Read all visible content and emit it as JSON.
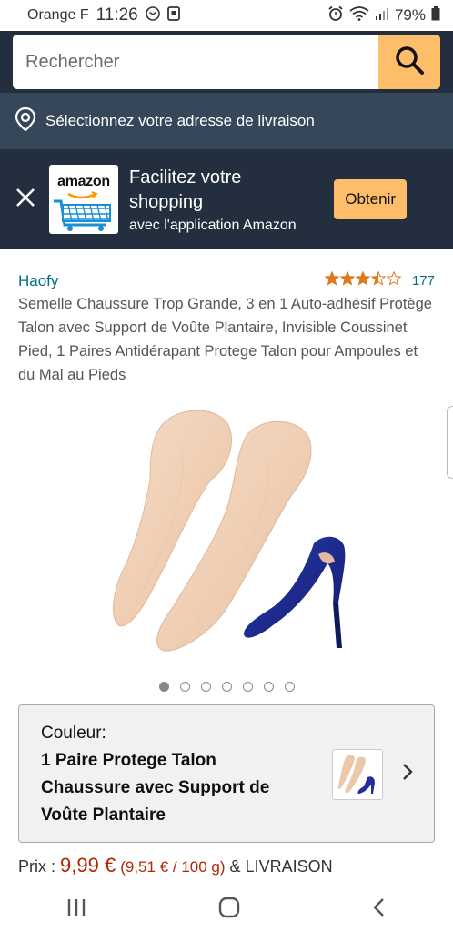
{
  "status_bar": {
    "carrier": "Orange F",
    "time": "11:26",
    "battery": "79%"
  },
  "search": {
    "placeholder": "Rechercher"
  },
  "delivery": {
    "label": "Sélectionnez votre adresse de livraison"
  },
  "app_banner": {
    "logo_text": "amazon",
    "line1": "Facilitez votre",
    "line2": "shopping",
    "line3": "avec l'application Amazon",
    "button": "Obtenir"
  },
  "product": {
    "brand": "Haofy",
    "rating_stars": 3.5,
    "rating_count": "177",
    "title": "Semelle Chaussure Trop Grande, 3 en 1 Auto-adhésif Protège Talon avec Support de Voûte Plantaire, Invisible Coussinet Pied, 1 Paires Antidérapant Protege Talon pour Ampoules et du Mal au Pieds",
    "image_count": 7,
    "active_image": 0
  },
  "color_selector": {
    "label": "Couleur:",
    "value": "1 Paire Protege Talon Chaussure avec Support de Voûte Plantaire"
  },
  "price": {
    "label": "Prix :",
    "amount": "9,99 €",
    "unit_price": "(9,51 € / 100 g)",
    "suffix": "& LIVRAISON"
  },
  "colors": {
    "header_dark": "#232f3e",
    "address_bar": "#37475a",
    "accent_orange": "#febd69",
    "link_teal": "#007185",
    "price_red": "#b12704"
  }
}
